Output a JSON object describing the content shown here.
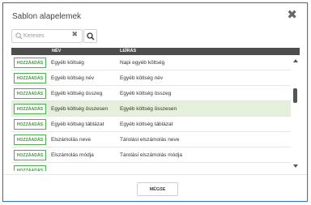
{
  "dialog": {
    "title": "Sablon alapelemek",
    "close_glyph": "✖"
  },
  "search": {
    "placeholder": "Keresés",
    "clear_glyph": "✖"
  },
  "table": {
    "columns": [
      "NÉV",
      "LEÍRÁS"
    ],
    "add_label": "HOZZÁADÁS",
    "rows": [
      {
        "name": "Egyéb költség",
        "description": "Napi egyéb költség",
        "highlighted": false
      },
      {
        "name": "Egyéb költség név",
        "description": "Egyéb költség név",
        "highlighted": false
      },
      {
        "name": "Egyéb költség összeg",
        "description": "Egyéb költség összeg",
        "highlighted": false
      },
      {
        "name": "Egyéb költség összesen",
        "description": "Egyéb költség összesen",
        "highlighted": true
      },
      {
        "name": "Egyéb költség táblázat",
        "description": "Egyéb költség táblázat",
        "highlighted": false
      },
      {
        "name": "Elszámolás neve",
        "description": "Tárolási elszámolás neve",
        "highlighted": false
      },
      {
        "name": "Elszámolás módja",
        "description": "Tárolási elszámolás módja",
        "highlighted": false
      },
      {
        "name": "",
        "description": "",
        "highlighted": false
      }
    ]
  },
  "footer": {
    "cancel_label": "MÉGSE"
  },
  "colors": {
    "border": "#3b73c9",
    "header_bg": "#4d4d4d",
    "add_green": "#3a9a3a",
    "highlight_row": "#e4efdc"
  }
}
